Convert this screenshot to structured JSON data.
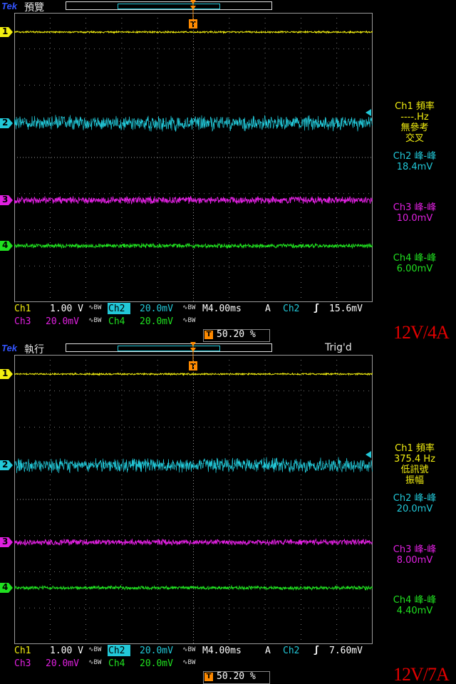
{
  "colors": {
    "ch1": "#f2ee10",
    "ch2": "#22c8d8",
    "ch3": "#e020e0",
    "ch4": "#20e020",
    "trigger": "#ff8a00",
    "annotation": "#e00000",
    "grid": "#9a9a9a"
  },
  "panels": [
    {
      "brand": "Tek",
      "mode": "預覽",
      "trig_state": "",
      "readouts": {
        "ch1_title": "Ch1 頻率",
        "ch1_value": "----.Hz",
        "ch1_note1": "無參考",
        "ch1_note2": "交叉",
        "ch2_title": "Ch2 峰-峰",
        "ch2_value": "18.4mV",
        "ch3_title": "Ch3 峰-峰",
        "ch3_value": "10.0mV",
        "ch4_title": "Ch4 峰-峰",
        "ch4_value": "6.00mV"
      },
      "channel_labels": [
        "1",
        "2",
        "3",
        "4"
      ],
      "settings": {
        "ch1_label": "Ch1",
        "ch1_scale": "1.00 V",
        "ch2_label": "Ch2",
        "ch2_scale": "20.0mV",
        "ch3_label": "Ch3",
        "ch3_scale": "20.0mV",
        "ch4_label": "Ch4",
        "ch4_scale": "20.0mV",
        "bw_limit": "∿BW",
        "timebase": "M4.00ms",
        "trig_mode": "A",
        "trig_source": "Ch2",
        "trig_slope": "ʃ",
        "trig_level": "15.6mV",
        "trig_position": "50.20 %"
      },
      "annotation": "12V/4A",
      "noise_amplitude": {
        "ch1": 1.2,
        "ch2": 10,
        "ch3": 5,
        "ch4": 3
      }
    },
    {
      "brand": "Tek",
      "mode": "執行",
      "trig_state": "Trig'd",
      "readouts": {
        "ch1_title": "Ch1 頻率",
        "ch1_value": "375.4 Hz",
        "ch1_note1": "低訊號",
        "ch1_note2": "振幅",
        "ch2_title": "Ch2 峰-峰",
        "ch2_value": "20.0mV",
        "ch3_title": "Ch3 峰-峰",
        "ch3_value": "8.00mV",
        "ch4_title": "Ch4 峰-峰",
        "ch4_value": "4.40mV"
      },
      "channel_labels": [
        "1",
        "2",
        "3",
        "4"
      ],
      "settings": {
        "ch1_label": "Ch1",
        "ch1_scale": "1.00 V",
        "ch2_label": "Ch2",
        "ch2_scale": "20.0mV",
        "ch3_label": "Ch3",
        "ch3_scale": "20.0mV",
        "ch4_label": "Ch4",
        "ch4_scale": "20.0mV",
        "bw_limit": "∿BW",
        "timebase": "M4.00ms",
        "trig_mode": "A",
        "trig_source": "Ch2",
        "trig_slope": "ʃ",
        "trig_level": "7.60mV",
        "trig_position": "50.20 %"
      },
      "annotation": "12V/7A",
      "noise_amplitude": {
        "ch1": 1.2,
        "ch2": 10,
        "ch3": 4,
        "ch4": 2.5
      }
    }
  ]
}
